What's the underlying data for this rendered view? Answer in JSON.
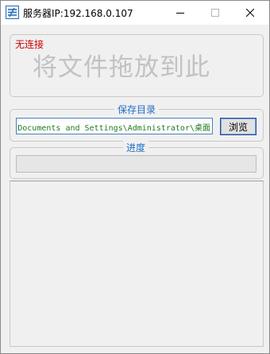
{
  "window": {
    "title": "服务器IP:192.168.0.107"
  },
  "drop_zone": {
    "status": "无连接",
    "hint": "将文件拖放到此"
  },
  "save_dir": {
    "legend": "保存目录",
    "path_value": "C:\\Documents and Settings\\Administrator\\桌面",
    "browse_label": "浏览"
  },
  "progress": {
    "legend": "进度",
    "value": 0
  },
  "log": {
    "text": ""
  },
  "colors": {
    "status": "#cc0000",
    "legend": "#1e6fc4",
    "path_text": "#1f7a1f",
    "hint": "#c2c2c2"
  }
}
